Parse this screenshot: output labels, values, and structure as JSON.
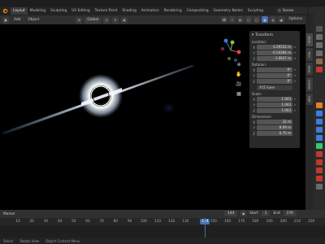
{
  "app": {
    "title_fragment": "B"
  },
  "workspaces": [
    "Layout",
    "Modeling",
    "Sculpting",
    "UV Editing",
    "Texture Paint",
    "Shading",
    "Animation",
    "Rendering",
    "Compositing",
    "Geometry Nodes",
    "Scripting"
  ],
  "scene_selector": {
    "label": "Scene"
  },
  "header": {
    "menus": [
      "Add",
      "Object"
    ],
    "orientation_label": "Global",
    "options_label": "Options"
  },
  "npanel": {
    "title": "Transform",
    "location": {
      "label": "Location:",
      "x": "0.29152 m",
      "y": "-0.54284 m",
      "z": "-1.9627 m"
    },
    "rotation": {
      "label": "Rotation:",
      "x": "0°",
      "y": "0°",
      "z": "0°"
    },
    "rotation_mode": "XYZ Euler",
    "scale": {
      "label": "Scale:",
      "x": "1.043",
      "y": "1.043",
      "z": "1.043"
    },
    "dimensions": {
      "label": "Dimensions:",
      "x": "32 m",
      "y": "8.09 m",
      "z": "6.75 m"
    }
  },
  "sidebar_tabs": [
    "Item",
    "Tool",
    "View",
    "Create",
    "Edit"
  ],
  "timeline": {
    "mode_label": "Marker",
    "ticks": [
      "10",
      "20",
      "30",
      "40",
      "50",
      "60",
      "70",
      "80",
      "90",
      "100",
      "110",
      "120",
      "130",
      "140",
      "150",
      "160",
      "170",
      "180",
      "190",
      "200",
      "210",
      "220",
      "230",
      "240",
      "250"
    ],
    "current_frame": "144",
    "current_frame_value": 144,
    "keying_label": "144",
    "start_label": "Start",
    "start_value": "1",
    "end_label": "End",
    "end_value": "176"
  },
  "statusbar": {
    "items": [
      "Select",
      "Rotate View",
      "Object Context Menu"
    ]
  },
  "colors": {
    "accent": "#4772b3",
    "viewport_bg": "#000000",
    "panel_bg": "#2c2c2c"
  }
}
